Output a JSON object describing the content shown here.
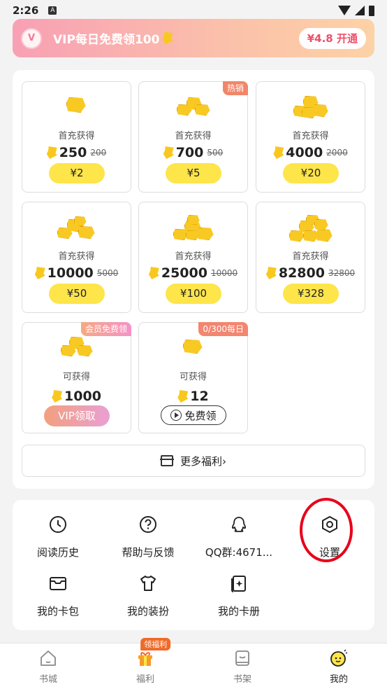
{
  "status": {
    "time": "2:26",
    "notif_glyph": "A"
  },
  "vip_banner": {
    "text": "VIP每日免费领100",
    "logo_glyph": "V",
    "btn_price": "¥4.8",
    "btn_label": "开通"
  },
  "packs": [
    {
      "label": "首充获得",
      "amount": "250",
      "original": "200",
      "price": "¥2"
    },
    {
      "label": "首充获得",
      "amount": "700",
      "original": "500",
      "price": "¥5",
      "tag": "热销"
    },
    {
      "label": "首充获得",
      "amount": "4000",
      "original": "2000",
      "price": "¥20"
    },
    {
      "label": "首充获得",
      "amount": "10000",
      "original": "5000",
      "price": "¥50"
    },
    {
      "label": "首充获得",
      "amount": "25000",
      "original": "10000",
      "price": "¥100"
    },
    {
      "label": "首充获得",
      "amount": "82800",
      "original": "32800",
      "price": "¥328"
    }
  ],
  "vip_pack": {
    "tag": "会员免费领",
    "label": "可获得",
    "amount": "1000",
    "button": "VIP领取"
  },
  "free_pack": {
    "tag": "0/300每日",
    "label": "可获得",
    "amount": "12",
    "button": "免费领"
  },
  "more_benefits": "更多福利",
  "more_benefits_arrow": "›",
  "menu": [
    {
      "label": "阅读历史",
      "icon": "clock-icon"
    },
    {
      "label": "帮助与反馈",
      "icon": "help-icon"
    },
    {
      "label": "QQ群:4671...",
      "icon": "qq-icon"
    },
    {
      "label": "设置",
      "icon": "settings-hexagon-icon"
    },
    {
      "label": "我的卡包",
      "icon": "card-wallet-icon"
    },
    {
      "label": "我的装扮",
      "icon": "tshirt-icon"
    },
    {
      "label": "我的卡册",
      "icon": "card-album-icon"
    }
  ],
  "tabs": [
    {
      "label": "书城",
      "icon": "home-icon"
    },
    {
      "label": "福利",
      "icon": "gift-icon",
      "badge": "领福利"
    },
    {
      "label": "书架",
      "icon": "bookshelf-icon"
    },
    {
      "label": "我的",
      "icon": "profile-face-icon",
      "active": true
    }
  ],
  "colors": {
    "accent_yellow": "#fde54a",
    "highlight_red": "#e8001a",
    "vip_pink": "#f8a0b4"
  }
}
